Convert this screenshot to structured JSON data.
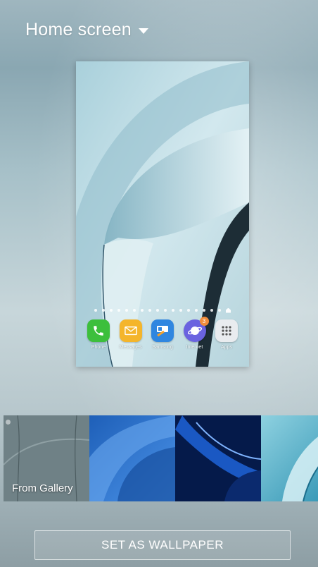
{
  "header": {
    "title": "Home screen",
    "dropdown_icon": "caret-down-icon"
  },
  "preview": {
    "pager_dots": 17,
    "dock_apps": [
      {
        "label": "Phone",
        "icon": "phone-icon",
        "color": "#3cbf3c"
      },
      {
        "label": "Messages",
        "icon": "messages-icon",
        "color": "#f4b52b"
      },
      {
        "label": "Samsung",
        "icon": "samsung-pay-icon",
        "color": "#2f86e0"
      },
      {
        "label": "Internet",
        "icon": "internet-icon",
        "color": "#6a63e0",
        "badge": "3"
      },
      {
        "label": "Apps",
        "icon": "apps-grid-icon",
        "color": "#e9ecef"
      }
    ]
  },
  "wallpapers": {
    "gallery_label": "From Gallery"
  },
  "actions": {
    "set_wallpaper_label": "SET AS WALLPAPER"
  },
  "colors": {
    "accent": "#ffffff",
    "badge": "#f08c3a"
  }
}
